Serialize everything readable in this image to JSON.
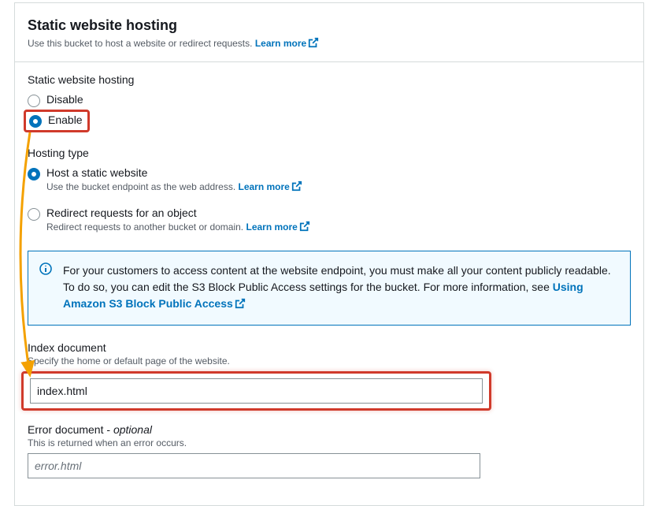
{
  "header": {
    "title": "Static website hosting",
    "subtitle": "Use this bucket to host a website or redirect requests. ",
    "learn_more": "Learn more"
  },
  "hosting_section": {
    "label": "Static website hosting",
    "options": {
      "disable": "Disable",
      "enable": "Enable"
    }
  },
  "hosting_type": {
    "label": "Hosting type",
    "static": {
      "label": "Host a static website",
      "desc": "Use the bucket endpoint as the web address. ",
      "learn_more": "Learn more"
    },
    "redirect": {
      "label": "Redirect requests for an object",
      "desc": "Redirect requests to another bucket or domain. ",
      "learn_more": "Learn more"
    }
  },
  "info_box": {
    "text": "For your customers to access content at the website endpoint, you must make all your content publicly readable. To do so, you can edit the S3 Block Public Access settings for the bucket. For more information, see ",
    "link": "Using Amazon S3 Block Public Access"
  },
  "index_doc": {
    "label": "Index document",
    "desc": "Specify the home or default page of the website.",
    "value": "index.html"
  },
  "error_doc": {
    "label_main": "Error document - ",
    "label_optional": "optional",
    "desc": "This is returned when an error occurs.",
    "placeholder": "error.html"
  }
}
